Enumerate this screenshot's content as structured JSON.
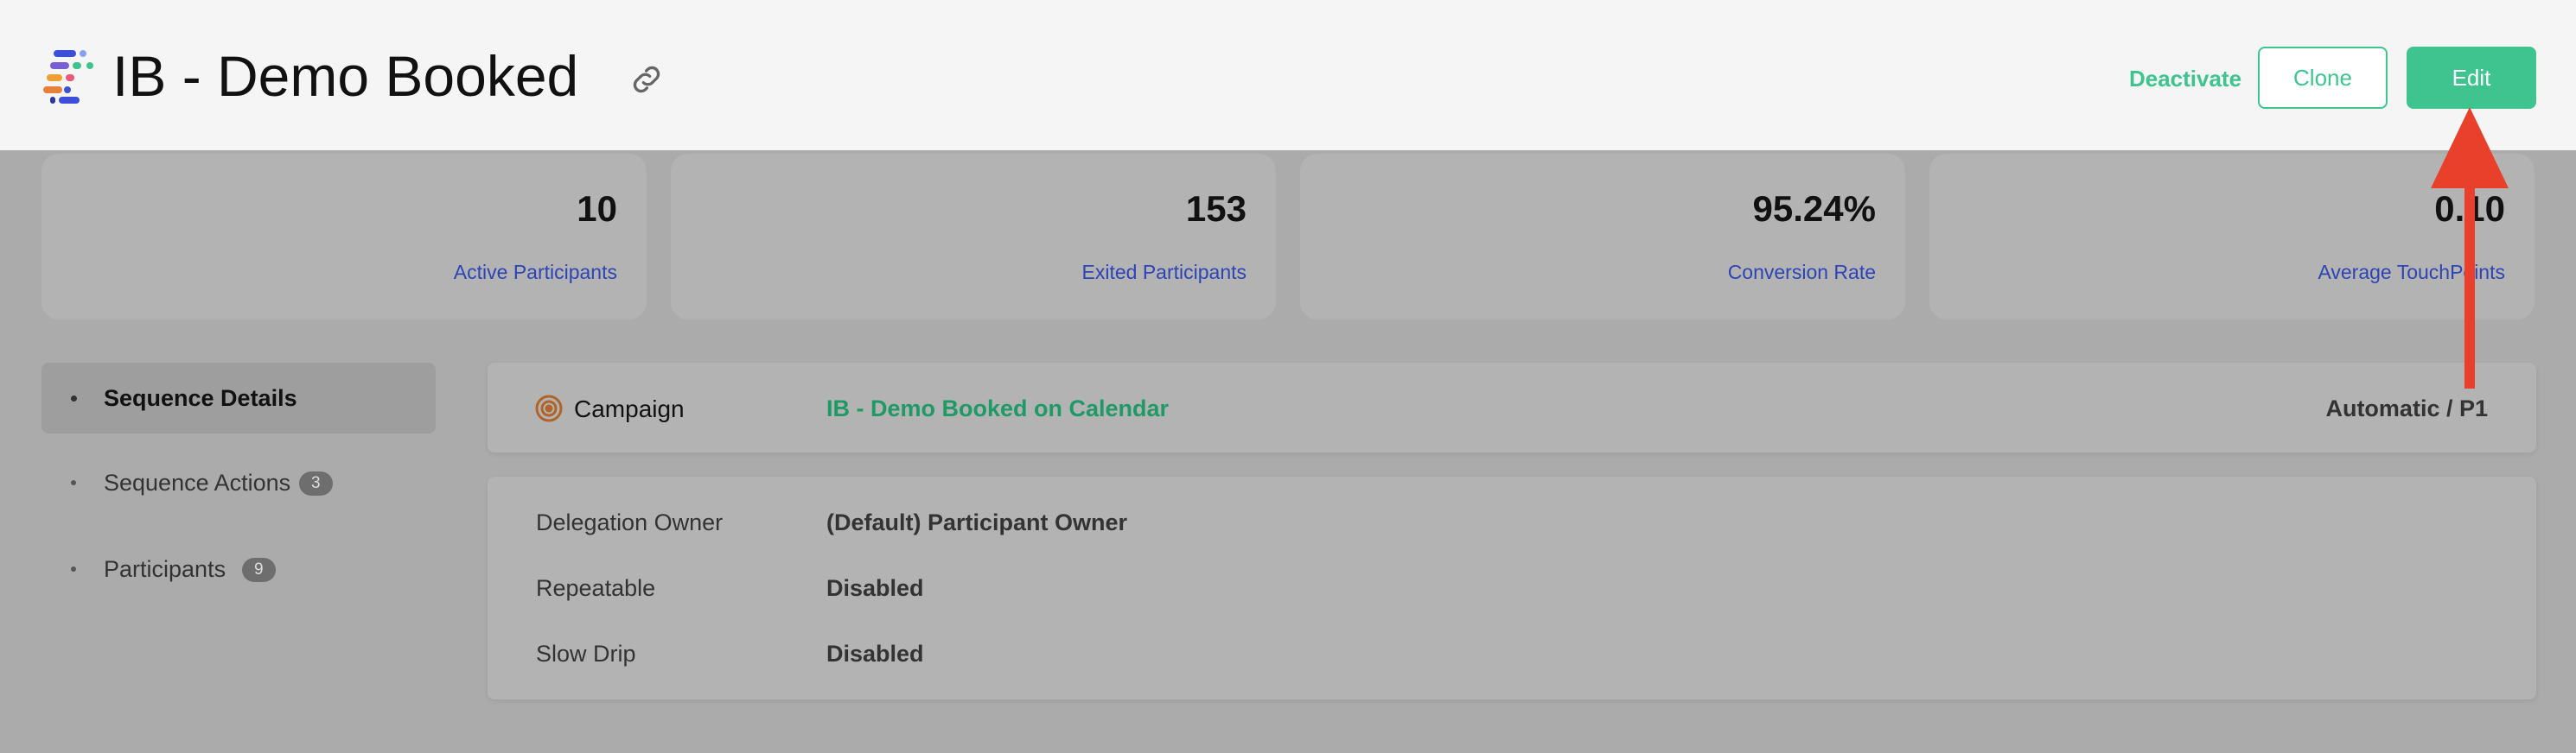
{
  "header": {
    "title": "IB - Demo Booked",
    "actions": {
      "deactivate_label": "Deactivate",
      "clone_label": "Clone",
      "edit_label": "Edit"
    }
  },
  "stats": [
    {
      "value": "10",
      "label": "Active Participants"
    },
    {
      "value": "153",
      "label": "Exited Participants"
    },
    {
      "value": "95.24%",
      "label": "Conversion Rate"
    },
    {
      "value": "0.10",
      "label": "Average TouchPoints"
    }
  ],
  "sidebar": {
    "items": [
      {
        "label": "Sequence Details",
        "active": true
      },
      {
        "label": "Sequence Actions",
        "badge": "3"
      },
      {
        "label": "Participants",
        "badge": "9"
      }
    ]
  },
  "campaign": {
    "label": "Campaign",
    "name": "IB - Demo Booked on Calendar",
    "mode": "Automatic / P1"
  },
  "details": [
    {
      "label": "Delegation Owner",
      "value": "(Default) Participant Owner"
    },
    {
      "label": "Repeatable",
      "value": "Disabled"
    },
    {
      "label": "Slow Drip",
      "value": "Disabled"
    }
  ],
  "colors": {
    "accent": "#3fc48f",
    "link_blue": "#2d44b5",
    "annotation_arrow": "#e8402b"
  },
  "icons": [
    "app-logo-icon",
    "link-icon",
    "target-icon",
    "arrow-up-annotation"
  ]
}
